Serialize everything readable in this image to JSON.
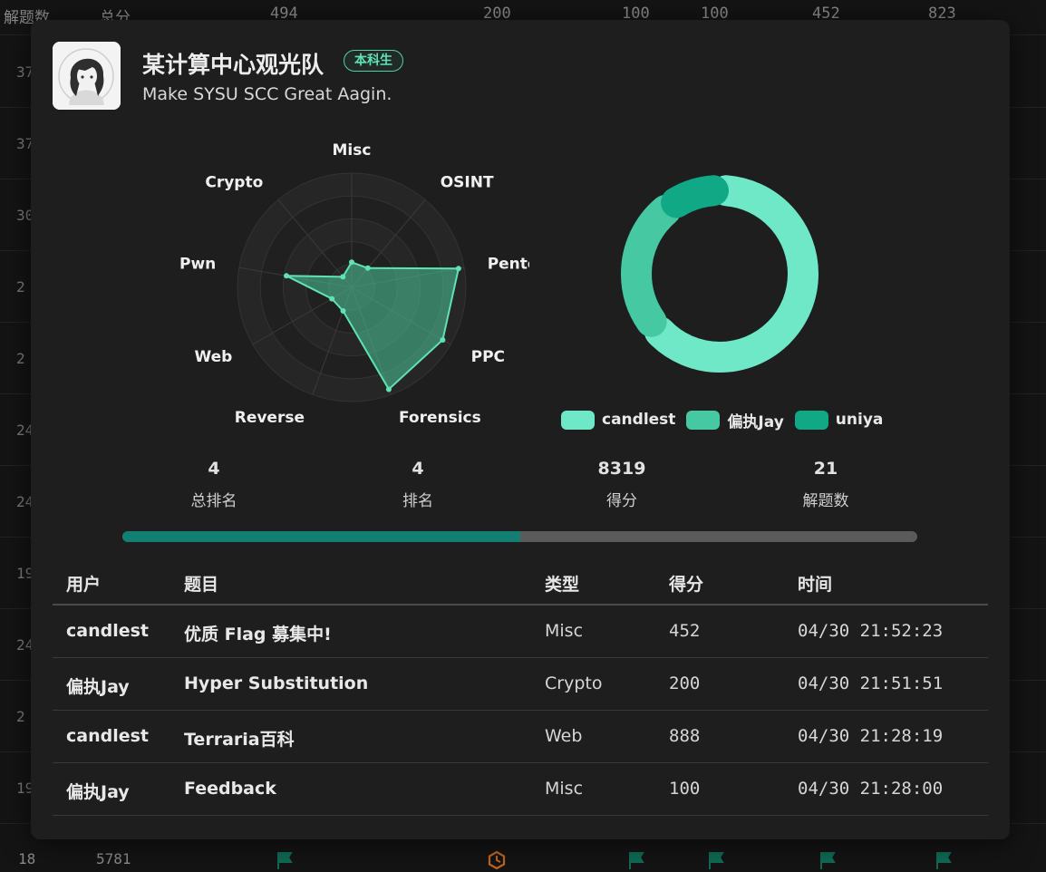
{
  "background": {
    "header": {
      "solved_label": "解题数",
      "total_label": "总分",
      "values": [
        "494",
        "200",
        "100",
        "100",
        "452",
        "823"
      ]
    },
    "row_prefixes": [
      "37",
      "37",
      "30",
      "2",
      "2",
      "24",
      "24",
      "19",
      "24",
      "2",
      "19"
    ],
    "bottom_row": {
      "rank": "18",
      "score": "5781"
    }
  },
  "team": {
    "name": "某计算中心观光队",
    "badge": "本科生",
    "motto": "Make SYSU SCC Great Aagin."
  },
  "radar": {
    "axes": [
      "Misc",
      "OSINT",
      "Pentest",
      "PPC",
      "Forensics",
      "Reverse",
      "Web",
      "Pwn",
      "Crypto"
    ],
    "values": [
      0.22,
      0.22,
      0.95,
      0.92,
      0.95,
      0.22,
      0.2,
      0.58,
      0.12
    ]
  },
  "donut": {
    "segments": [
      {
        "name": "candlest",
        "value": 0.64,
        "color": "#6fe8c8"
      },
      {
        "name": "偏执Jay",
        "value": 0.26,
        "color": "#46c9a2"
      },
      {
        "name": "uniya",
        "value": 0.1,
        "color": "#11a886"
      }
    ]
  },
  "stats": [
    {
      "value": "4",
      "label": "总排名"
    },
    {
      "value": "4",
      "label": "排名"
    },
    {
      "value": "8319",
      "label": "得分"
    },
    {
      "value": "21",
      "label": "解题数"
    }
  ],
  "progress": {
    "fraction": 0.5
  },
  "solves": {
    "columns": [
      "用户",
      "题目",
      "类型",
      "得分",
      "时间"
    ],
    "rows": [
      {
        "user": "candlest",
        "title": "优质 Flag 募集中!",
        "type": "Misc",
        "score": "452",
        "time": "04/30 21:52:23"
      },
      {
        "user": "偏执Jay",
        "title": "Hyper Substitution",
        "type": "Crypto",
        "score": "200",
        "time": "04/30 21:51:51"
      },
      {
        "user": "candlest",
        "title": "Terraria百科",
        "type": "Web",
        "score": "888",
        "time": "04/30 21:28:19"
      },
      {
        "user": "偏执Jay",
        "title": "Feedback",
        "type": "Misc",
        "score": "100",
        "time": "04/30 21:28:00"
      }
    ]
  }
}
